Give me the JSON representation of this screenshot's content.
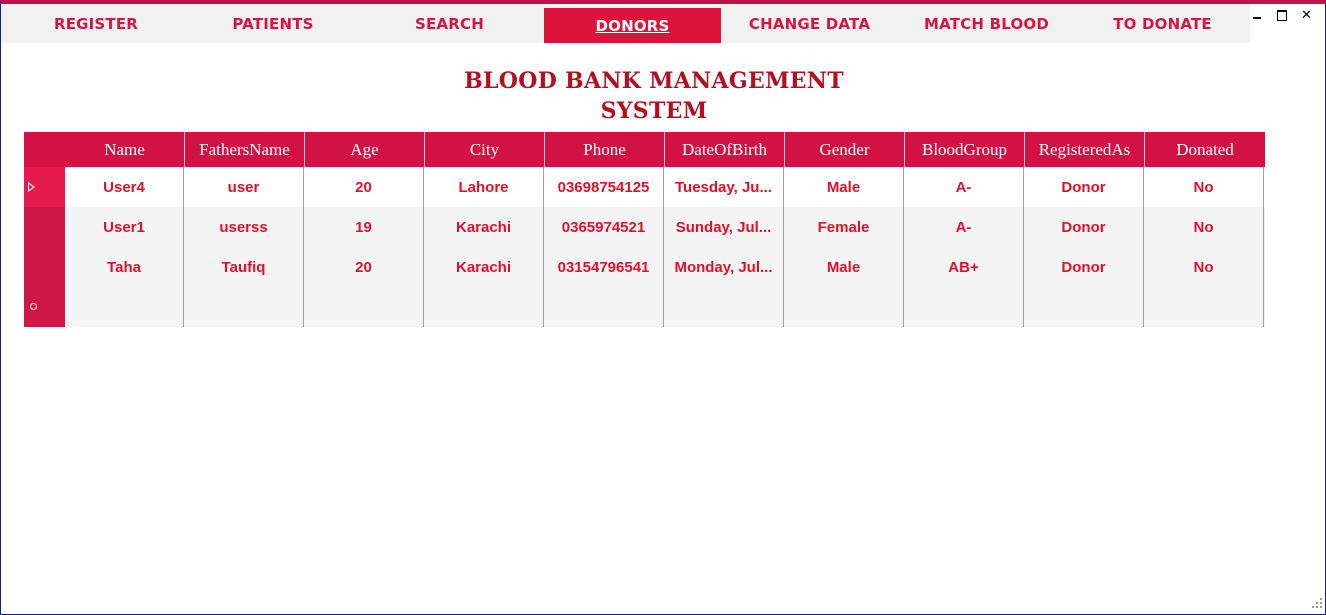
{
  "nav": {
    "items": [
      {
        "label": "Register"
      },
      {
        "label": "Patients"
      },
      {
        "label": "Search"
      },
      {
        "label": "Donors"
      },
      {
        "label": "Change Data"
      },
      {
        "label": "Match Blood"
      },
      {
        "label": "To Donate"
      }
    ],
    "active_index": 3
  },
  "window": {
    "minimize": "–",
    "maximize": "□",
    "close": "✕"
  },
  "title": {
    "line1": "Blood Bank Management",
    "line2": "System"
  },
  "grid": {
    "columns": [
      "Name",
      "FathersName",
      "Age",
      "City",
      "Phone",
      "DateOfBirth",
      "Gender",
      "BloodGroup",
      "RegisteredAs",
      "Donated"
    ],
    "rows": [
      [
        "User4",
        "user",
        "20",
        "Lahore",
        "03698754125",
        "Tuesday, Ju...",
        "Male",
        "A-",
        "Donor",
        "No"
      ],
      [
        "User1",
        "userss",
        "19",
        "Karachi",
        "0365974521",
        "Sunday, Jul...",
        "Female",
        "A-",
        "Donor",
        "No"
      ],
      [
        "Taha",
        "Taufiq",
        "20",
        "Karachi",
        "03154796541",
        "Monday, Jul...",
        "Male",
        "AB+",
        "Donor",
        "No"
      ]
    ],
    "selected_row": 0
  },
  "colors": {
    "accent": "#dc143c",
    "header_bg": "#d21245",
    "text_red": "#e0102a",
    "title_red": "#b01020"
  }
}
